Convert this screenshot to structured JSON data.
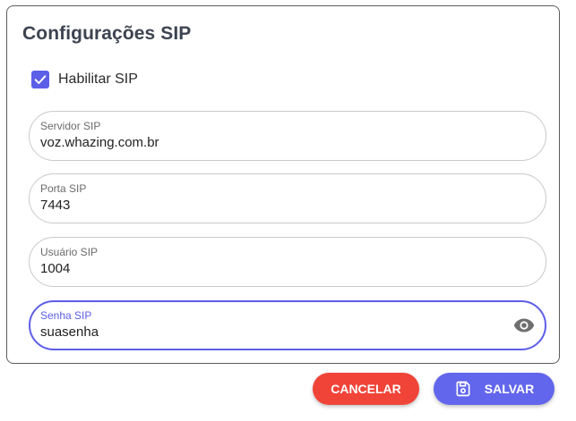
{
  "dialog": {
    "title": "Configurações SIP"
  },
  "checkbox": {
    "label": "Habilitar SIP",
    "checked": true,
    "icon": "check-icon"
  },
  "fields": [
    {
      "label": "Servidor SIP",
      "value": "voz.whazing.com.br"
    },
    {
      "label": "Porta SIP",
      "value": "7443"
    },
    {
      "label": "Usuário SIP",
      "value": "1004"
    },
    {
      "label": "Senha SIP",
      "value": "suasenha",
      "focused": true,
      "icon": "eye-icon"
    }
  ],
  "buttons": {
    "cancel_label": "CANCELAR",
    "save_label": "SALVAR",
    "save_icon": "save-icon"
  },
  "colors": {
    "accent": "#5c5fe8",
    "cancel": "#f04438",
    "save": "#6266ec",
    "title": "#3d4451"
  }
}
